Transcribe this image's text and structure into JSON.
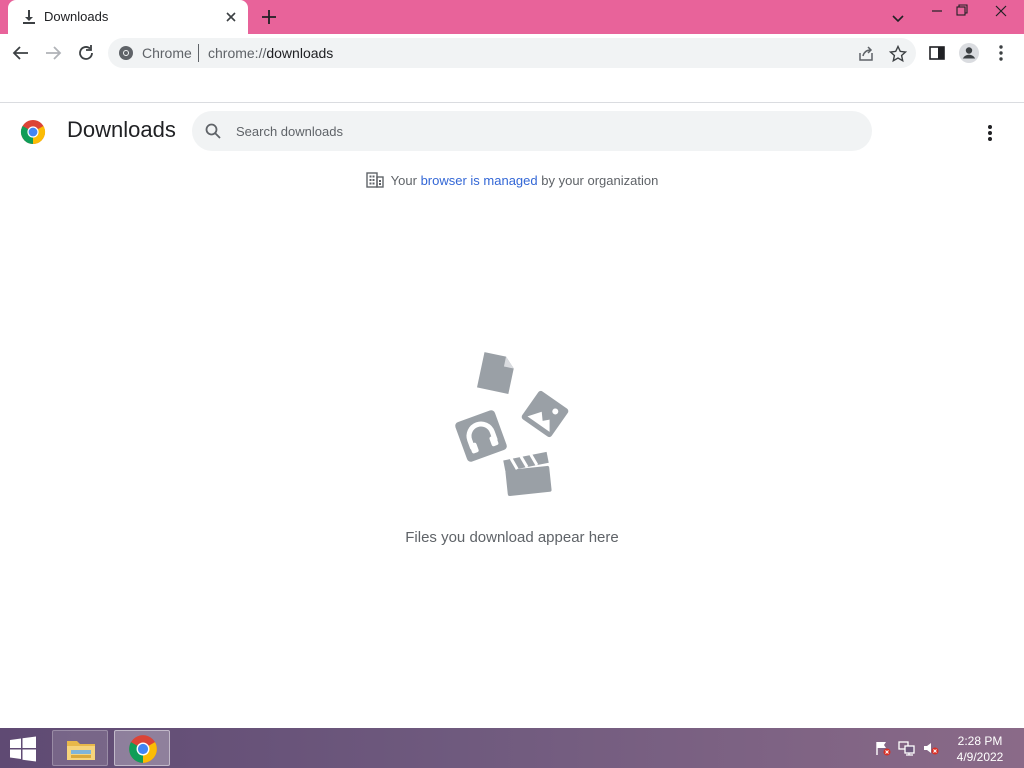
{
  "tab": {
    "title": "Downloads"
  },
  "omnibox": {
    "chip": "Chrome",
    "url_scheme": "chrome://",
    "url_path": "downloads"
  },
  "header": {
    "title": "Downloads"
  },
  "search": {
    "placeholder": "Search downloads",
    "value": ""
  },
  "managed": {
    "prefix": "Your",
    "link": "browser is managed",
    "suffix": "by your organization"
  },
  "empty": {
    "message": "Files you download appear here"
  },
  "taskbar": {
    "time": "2:28 PM",
    "date": "4/9/2022"
  },
  "colors": {
    "tabstrip": "#e8639a",
    "accent": "#1a73e8",
    "icon_gray": "#9aa0a6"
  }
}
